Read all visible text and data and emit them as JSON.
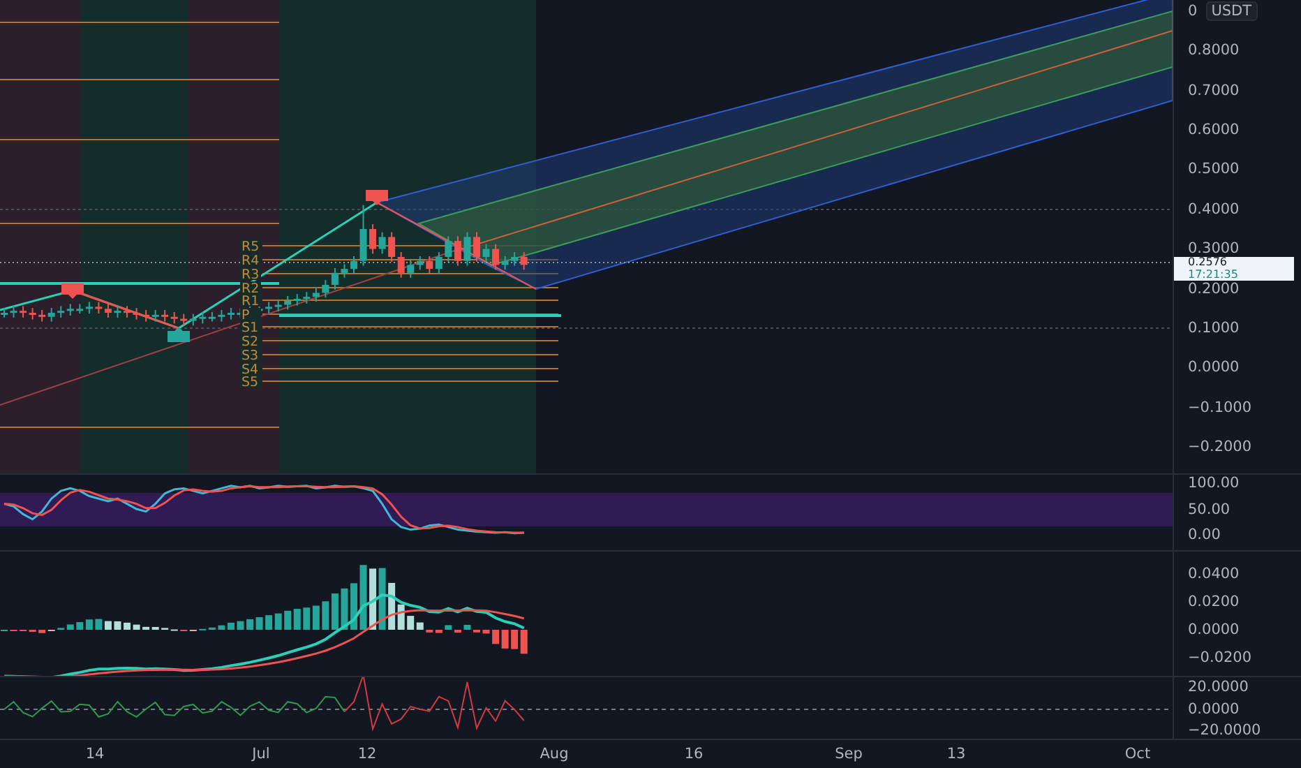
{
  "price_axis": {
    "labels": [
      "0",
      "0.8000",
      "0.7000",
      "0.6000",
      "0.5000",
      "0.4000",
      "0.3000",
      "0.2000",
      "0.1000",
      "0.0000",
      "−0.1000",
      "−0.2000"
    ],
    "currency": "USDT"
  },
  "last_price": {
    "price": "0.2576",
    "countdown": "17:21:35"
  },
  "pivot_labels": [
    "R5",
    "R4",
    "R3",
    "R2",
    "R1",
    "P",
    "S1",
    "S2",
    "S3",
    "S4",
    "S5"
  ],
  "stoch_axis": [
    "100.00",
    "50.00",
    "0.00"
  ],
  "macd_axis": [
    "0.0400",
    "0.0200",
    "0.0000",
    "−0.0200"
  ],
  "oscillator_axis": [
    "20.0000",
    "0.0000",
    "−20.0000"
  ],
  "time_axis": [
    "14",
    "Jul",
    "12",
    "Aug",
    "16",
    "Sep",
    "13",
    "Oct"
  ]
}
